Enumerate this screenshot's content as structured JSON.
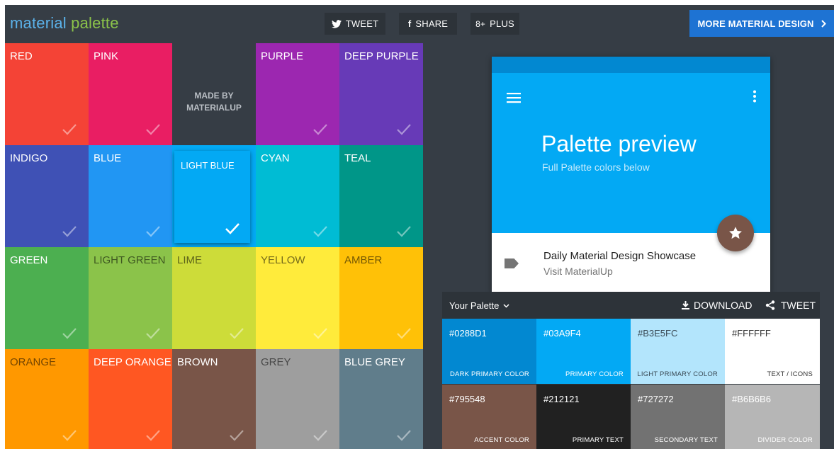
{
  "header": {
    "logo_word1": "material",
    "logo_word2": "palette",
    "tweet_label": "TWEET",
    "share_label": "SHARE",
    "plus_label": "PLUS",
    "plus_icon_text": "8+",
    "more_label": "MORE MATERIAL DESIGN"
  },
  "grid": {
    "colors": [
      {
        "name": "RED",
        "hex": "#f44336"
      },
      {
        "name": "PINK",
        "hex": "#e91e63"
      },
      {
        "name": "",
        "hex": "#363d45"
      },
      {
        "name": "PURPLE",
        "hex": "#9c27b0"
      },
      {
        "name": "DEEP PURPLE",
        "hex": "#673ab7"
      },
      {
        "name": "INDIGO",
        "hex": "#3f51b5"
      },
      {
        "name": "BLUE",
        "hex": "#2196f3"
      },
      {
        "name": "LIGHT BLUE",
        "hex": "#03a9f4"
      },
      {
        "name": "CYAN",
        "hex": "#00bcd4"
      },
      {
        "name": "TEAL",
        "hex": "#009688"
      },
      {
        "name": "GREEN",
        "hex": "#4caf50"
      },
      {
        "name": "LIGHT GREEN",
        "hex": "#8bc34a"
      },
      {
        "name": "LIME",
        "hex": "#cddc39"
      },
      {
        "name": "YELLOW",
        "hex": "#ffeb3b"
      },
      {
        "name": "AMBER",
        "hex": "#ffc107"
      },
      {
        "name": "ORANGE",
        "hex": "#ff9800"
      },
      {
        "name": "DEEP ORANGE",
        "hex": "#ff5722"
      },
      {
        "name": "BROWN",
        "hex": "#795548"
      },
      {
        "name": "GREY",
        "hex": "#9e9e9e"
      },
      {
        "name": "BLUE GREY",
        "hex": "#607d8b"
      }
    ],
    "made_by_line1": "MADE BY",
    "made_by_line2": "MATERIALUP",
    "selected_label": "LIGHT BLUE"
  },
  "preview": {
    "title": "Palette preview",
    "subtitle": "Full Palette colors below",
    "list_title": "Daily Material Design Showcase",
    "list_subtitle": "Visit MaterialUp",
    "statusbar_color": "#0288d1",
    "appbar_color": "#03a9f4",
    "fab_color": "#795548"
  },
  "palette": {
    "title": "Your Palette",
    "download_label": "DOWNLOAD",
    "tweet_label": "TWEET",
    "swatches": [
      {
        "hex": "#0288D1",
        "role": "DARK PRIMARY COLOR"
      },
      {
        "hex": "#03A9F4",
        "role": "PRIMARY COLOR"
      },
      {
        "hex": "#B3E5FC",
        "role": "LIGHT PRIMARY COLOR"
      },
      {
        "hex": "#FFFFFF",
        "role": "TEXT / ICONS"
      },
      {
        "hex": "#795548",
        "role": "ACCENT COLOR"
      },
      {
        "hex": "#212121",
        "role": "PRIMARY TEXT"
      },
      {
        "hex": "#727272",
        "role": "SECONDARY TEXT"
      },
      {
        "hex": "#B6B6B6",
        "role": "DIVIDER COLOR"
      }
    ]
  }
}
